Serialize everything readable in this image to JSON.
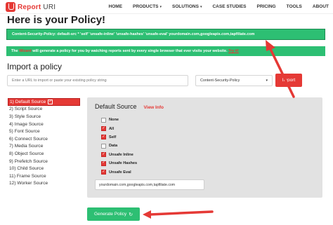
{
  "nav": {
    "logo_brand": "Report",
    "logo_suffix": " URI",
    "links": [
      {
        "label": "HOME",
        "dropdown": false
      },
      {
        "label": "PRODUCTS",
        "dropdown": true
      },
      {
        "label": "SOLUTIONS",
        "dropdown": true
      },
      {
        "label": "CASE STUDIES",
        "dropdown": false
      },
      {
        "label": "PRICING",
        "dropdown": false
      },
      {
        "label": "TOOLS",
        "dropdown": false
      },
      {
        "label": "ABOUT",
        "dropdown": false
      }
    ]
  },
  "page_title": "Here is your Policy!",
  "policy_text": "Content-Security-Policy: default-src * 'self' 'unsafe-inline' 'unsafe-hashes' 'unsafe-eval' yourdomain.com,googleapis.com,tapfiliate.com",
  "wizard": {
    "prefix": "The ",
    "highlight": "Wizard",
    "middle": " will generate a policy for you by watching reports sent by every single browser that ever visits your website. ",
    "link": "Try it!"
  },
  "import": {
    "title": "Import a policy",
    "placeholder": "Enter a URL to import or paste your existing policy string",
    "select_value": "Content-Security-Policy",
    "button": "Import"
  },
  "sidebar": {
    "items": [
      {
        "label": "1) Default Source",
        "active": true
      },
      {
        "label": "2) Script Source",
        "active": false
      },
      {
        "label": "3) Style Source",
        "active": false
      },
      {
        "label": "4) Image Source",
        "active": false
      },
      {
        "label": "5) Font Source",
        "active": false
      },
      {
        "label": "6) Connect Source",
        "active": false
      },
      {
        "label": "7) Media Source",
        "active": false
      },
      {
        "label": "8) Object Source",
        "active": false
      },
      {
        "label": "9) Prefetch Source",
        "active": false
      },
      {
        "label": "10) Child Source",
        "active": false
      },
      {
        "label": "11) Frame Source",
        "active": false
      },
      {
        "label": "12) Worker Source",
        "active": false
      }
    ]
  },
  "panel": {
    "title": "Default Source",
    "view_info": "View Info",
    "options": [
      {
        "label": "None",
        "checked": false
      },
      {
        "label": "All",
        "checked": true
      },
      {
        "label": "Self",
        "checked": true
      },
      {
        "label": "Data",
        "checked": false
      },
      {
        "label": "Unsafe Inline",
        "checked": true
      },
      {
        "label": "Unsafe Hashes",
        "checked": true
      },
      {
        "label": "Unsafe Eval",
        "checked": true
      }
    ],
    "domains": "yourdomain.com,googleapis.com,tapfiliate.com"
  },
  "generate_button": "Generate Policy",
  "colors": {
    "accent_red": "#e53935",
    "accent_green": "#2dbf73",
    "panel_gray": "#e2e2e2"
  }
}
